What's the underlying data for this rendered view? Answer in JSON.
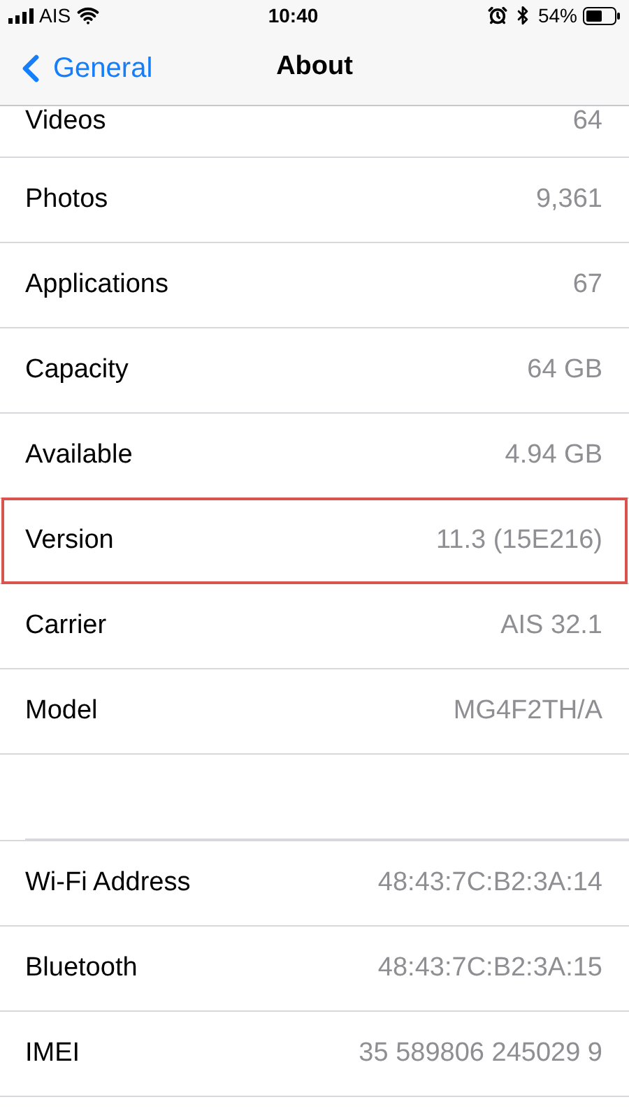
{
  "status_bar": {
    "carrier": "AIS",
    "time": "10:40",
    "battery": "54%"
  },
  "nav": {
    "back": "General",
    "title": "About"
  },
  "rows": [
    {
      "label": "Videos",
      "value": "64",
      "highlighted": false,
      "kind": "partial"
    },
    {
      "label": "Photos",
      "value": "9,361",
      "highlighted": false,
      "kind": "row"
    },
    {
      "label": "Applications",
      "value": "67",
      "highlighted": false,
      "kind": "row"
    },
    {
      "label": "Capacity",
      "value": "64 GB",
      "highlighted": false,
      "kind": "row"
    },
    {
      "label": "Available",
      "value": "4.94 GB",
      "highlighted": false,
      "kind": "row"
    },
    {
      "label": "Version",
      "value": "11.3 (15E216)",
      "highlighted": true,
      "kind": "row"
    },
    {
      "label": "Carrier",
      "value": "AIS 32.1",
      "highlighted": false,
      "kind": "row"
    },
    {
      "label": "Model",
      "value": "MG4F2TH/A",
      "highlighted": false,
      "kind": "row"
    },
    {
      "kind": "blank"
    },
    {
      "label": "Wi-Fi Address",
      "value": "48:43:7C:B2:3A:14",
      "highlighted": false,
      "kind": "row"
    },
    {
      "label": "Bluetooth",
      "value": "48:43:7C:B2:3A:15",
      "highlighted": false,
      "kind": "row"
    },
    {
      "label": "IMEI",
      "value": "35 589806 245029 9",
      "highlighted": false,
      "kind": "row"
    }
  ]
}
